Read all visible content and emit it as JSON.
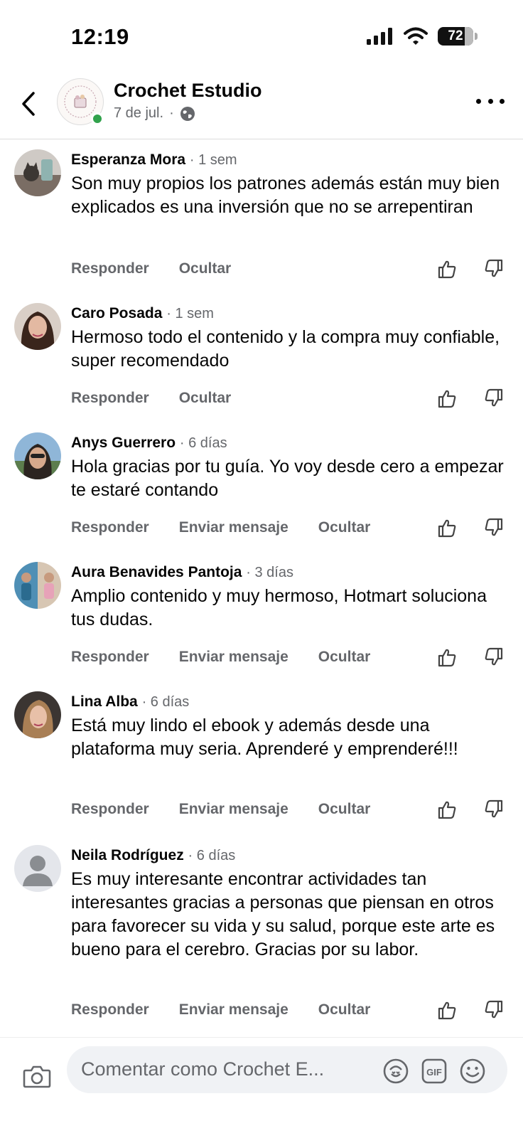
{
  "status_bar": {
    "time": "12:19",
    "battery": "72"
  },
  "header": {
    "page_name": "Crochet Estudio",
    "date": "7 de jul.",
    "separator": "·"
  },
  "comments": [
    {
      "author": "Esperanza Mora",
      "time": "· 1 sem",
      "text": "Son muy propios los patrones además están muy bien explicados es una inversión que no se arrepentiran",
      "actions": [
        "Responder",
        "Ocultar"
      ]
    },
    {
      "author": "Caro Posada",
      "time": "· 1 sem",
      "text": "Hermoso todo el contenido y la compra muy confiable, super recomendado",
      "actions": [
        "Responder",
        "Ocultar"
      ]
    },
    {
      "author": "Anys Guerrero",
      "time": "· 6 días",
      "text": "Hola gracias por tu guía. Yo voy desde cero a empezar te estaré contando",
      "actions": [
        "Responder",
        "Enviar mensaje",
        "Ocultar"
      ]
    },
    {
      "author": "Aura Benavides Pantoja",
      "time": "· 3 días",
      "text": "Amplio contenido y muy hermoso, Hotmart soluciona tus dudas.",
      "actions": [
        "Responder",
        "Enviar mensaje",
        "Ocultar"
      ]
    },
    {
      "author": "Lina Alba",
      "time": "· 6 días",
      "text": "Está muy lindo el ebook y además desde una plataforma muy seria.  Aprenderé y emprenderé!!!",
      "actions": [
        "Responder",
        "Enviar mensaje",
        "Ocultar"
      ]
    },
    {
      "author": "Neila Rodríguez",
      "time": "· 6 días",
      "text": "Es muy interesante encontrar actividades tan interesantes gracias a personas que piensan en otros para favorecer su vida y su salud, porque este arte es bueno para el cerebro. Gracias por su labor.",
      "actions": [
        "Responder",
        "Enviar mensaje",
        "Ocultar"
      ]
    }
  ],
  "composer": {
    "placeholder": "Comentar como Crochet E..."
  },
  "colors": {
    "online": "#31a24c",
    "muted_text": "#65676b",
    "input_bg": "#f0f2f5"
  }
}
